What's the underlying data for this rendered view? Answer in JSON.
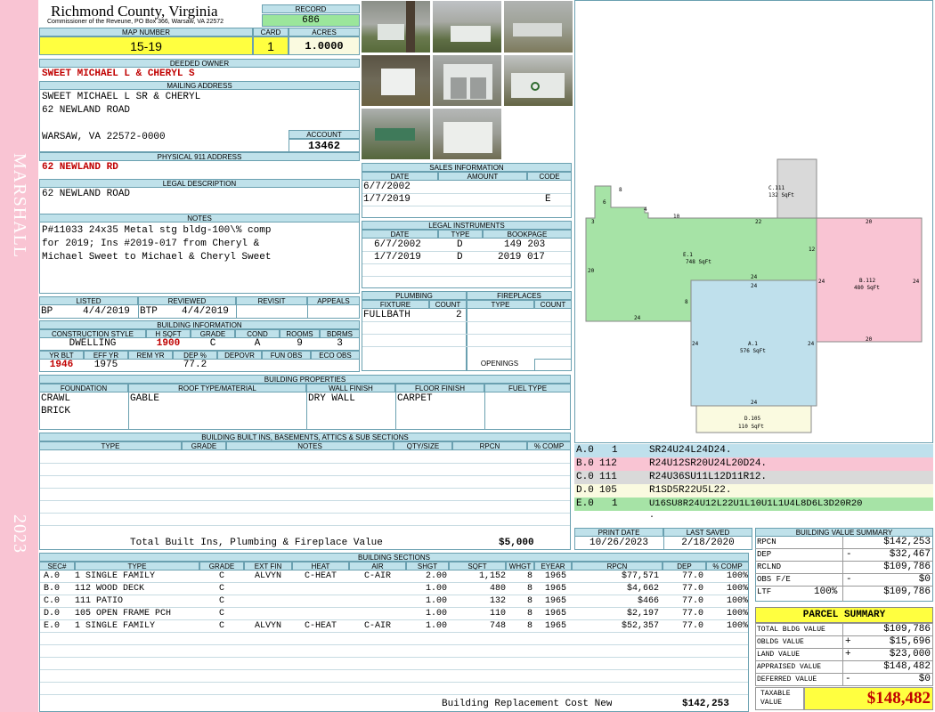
{
  "header": {
    "county": "Richmond County, Virginia",
    "commissioner": "Commissioner of the Reveune, PO Box 366, Warsaw, VA 22572",
    "record_label": "RECORD",
    "record": "686",
    "map_number_label": "MAP NUMBER",
    "map_number": "15-19",
    "card_label": "CARD",
    "card": "1",
    "acres_label": "ACRES",
    "acres": "1.0000"
  },
  "sidebar": {
    "district": "MARSHALL",
    "year": "2023"
  },
  "owner": {
    "deeded_owner_label": "DEEDED OWNER",
    "deeded_owner": "SWEET MICHAEL L & CHERYL S",
    "mailing_label": "MAILING ADDRESS",
    "mailing_lines": [
      "SWEET MICHAEL L SR & CHERYL",
      "62 NEWLAND ROAD",
      "",
      "WARSAW, VA 22572-0000"
    ],
    "account_label": "ACCOUNT",
    "account": "13462",
    "physical_label": "PHYSICAL 911 ADDRESS",
    "physical": "62 NEWLAND RD",
    "legal_label": "LEGAL DESCRIPTION",
    "legal": "62 NEWLAND ROAD",
    "notes_label": "NOTES",
    "notes_lines": [
      "P#11033 24x35 Metal stg bldg-100\\% comp",
      "for 2019; Ins #2019-017 from Cheryl &",
      "Michael Sweet to Michael & Cheryl Sweet"
    ]
  },
  "listing": {
    "listed_label": "LISTED",
    "reviewed_label": "REVIEWED",
    "revisit_label": "REVISIT",
    "appeals_label": "APPEALS",
    "listed_by": "BP",
    "listed_date": "4/4/2019",
    "reviewed_by": "BTP",
    "reviewed_date": "4/4/2019"
  },
  "building_info": {
    "title": "BUILDING INFORMATION",
    "headers": [
      "CONSTRUCTION STYLE",
      "H SQFT",
      "GRADE",
      "COND",
      "ROOMS",
      "BDRMS"
    ],
    "values": [
      "DWELLING",
      "1900",
      "C",
      "A",
      "9",
      "3"
    ],
    "headers2": [
      "YR BLT",
      "EFF YR",
      "REM YR",
      "DEP %",
      "DEPOVR",
      "FUN OBS",
      "ECO OBS"
    ],
    "values2": [
      "1946",
      "1975",
      "",
      "77.2",
      "",
      "",
      ""
    ]
  },
  "properties": {
    "title": "BUILDING PROPERTIES",
    "headers": [
      "FOUNDATION",
      "ROOF TYPE/MATERIAL",
      "WALL FINISH",
      "FLOOR FINISH",
      "FUEL TYPE"
    ],
    "foundation": [
      "CRAWL",
      "BRICK"
    ],
    "roof": "GABLE",
    "wall": "DRY WALL",
    "floor": "CARPET"
  },
  "builtins": {
    "title": "BUILDING BUILT INS, BASEMENTS, ATTICS & SUB SECTIONS",
    "headers": [
      "TYPE",
      "GRADE",
      "NOTES",
      "QTY/SIZE",
      "RPCN",
      "% COMP"
    ],
    "total_label": "Total Built Ins, Plumbing & Fireplace Value",
    "total_value": "$5,000"
  },
  "sales": {
    "title": "SALES INFORMATION",
    "headers": [
      "DATE",
      "AMOUNT",
      "CODE"
    ],
    "rows": [
      {
        "date": "6/7/2002",
        "amount": "",
        "code": ""
      },
      {
        "date": "1/7/2019",
        "amount": "",
        "code": "E"
      }
    ]
  },
  "legal_instruments": {
    "title": "LEGAL INSTRUMENTS",
    "headers": [
      "DATE",
      "TYPE",
      "BOOKPAGE"
    ],
    "rows": [
      {
        "date": "6/7/2002",
        "type": "D",
        "book": "149 203"
      },
      {
        "date": "1/7/2019",
        "type": "D",
        "book": "2019 017"
      }
    ]
  },
  "plumbing": {
    "title": "PLUMBING",
    "headers": [
      "FIXTURE",
      "COUNT"
    ],
    "fixture": "FULLBATH",
    "count": "2"
  },
  "fireplaces": {
    "title": "FIREPLACES",
    "headers": [
      "TYPE",
      "COUNT"
    ],
    "openings_label": "OPENINGS"
  },
  "sketch": {
    "labels": [
      {
        "id": "A.1",
        "area": "576 SqFt"
      },
      {
        "id": "B.112",
        "area": "480 SqFt"
      },
      {
        "id": "C.111",
        "area": "132 SqFt"
      },
      {
        "id": "D.105",
        "area": "110 SqFt"
      },
      {
        "id": "E.1",
        "area": "748 SqFt"
      }
    ],
    "dims": [
      "8",
      "6",
      "4",
      "3",
      "10",
      "22",
      "20",
      "12",
      "20",
      "24",
      "24",
      "24",
      "24",
      "24",
      "20",
      "24",
      "8",
      "20",
      "24",
      "24",
      "24",
      "24"
    ],
    "commands": [
      {
        "sec": "A.0",
        "code": "1",
        "cmd": "SR24U24L24D24.",
        "color": "#bfe0ec"
      },
      {
        "sec": "B.0",
        "code": "112",
        "cmd": "R24U12SR20U24L20D24.",
        "color": "#f9c4d3"
      },
      {
        "sec": "C.0",
        "code": "111",
        "cmd": "R24U36SU11L12D11R12.",
        "color": "#d9d9d9"
      },
      {
        "sec": "D.0",
        "code": "105",
        "cmd": "R1SD5R22U5L22.",
        "color": "#fafae0"
      },
      {
        "sec": "E.0",
        "code": "1",
        "cmd": "U16SU8R24U12L22U1L10U1L1U4L8D6L3D20R20",
        "color": "#a6e3a6"
      }
    ],
    "dot": "."
  },
  "dates": {
    "print_label": "PRINT DATE",
    "print_date": "10/26/2023",
    "saved_label": "LAST SAVED",
    "saved_date": "2/18/2020"
  },
  "value_summary": {
    "title": "BUILDING VALUE SUMMARY",
    "rows": [
      {
        "label": "RPCN",
        "sign": "",
        "pct": "",
        "value": "$142,253"
      },
      {
        "label": "DEP",
        "sign": "-",
        "pct": "",
        "value": "$32,467"
      },
      {
        "label": "RCLND",
        "sign": "",
        "pct": "",
        "value": "$109,786"
      },
      {
        "label": "OBS F/E",
        "sign": "-",
        "pct": "",
        "value": "$0"
      },
      {
        "label": "LTF",
        "sign": "",
        "pct": "100%",
        "value": "$109,786"
      }
    ]
  },
  "parcel_summary": {
    "title": "PARCEL SUMMARY",
    "rows": [
      {
        "label": "TOTAL BLDG VALUE",
        "sign": "",
        "value": "$109,786"
      },
      {
        "label": "OBLDG VALUE",
        "sign": "+",
        "value": "$15,696"
      },
      {
        "label": "LAND VALUE",
        "sign": "+",
        "value": "$23,000"
      },
      {
        "label": "APPRAISED VALUE",
        "sign": "",
        "value": "$148,482"
      },
      {
        "label": "DEFERRED VALUE",
        "sign": "-",
        "value": "$0"
      }
    ],
    "taxable_label": "TAXABLE VALUE",
    "taxable_value": "$148,482"
  },
  "sections": {
    "title": "BUILDING SECTIONS",
    "headers": [
      "SEC#",
      "TYPE",
      "GRADE",
      "EXT FIN",
      "HEAT",
      "AIR",
      "SHGT",
      "SQFT",
      "WHGT",
      "EYEAR",
      "RPCN",
      "DEP",
      "% COMP"
    ],
    "rows": [
      [
        "A.0",
        "1 SINGLE FAMILY",
        "C",
        "ALVYN",
        "C-HEAT",
        "C-AIR",
        "2.00",
        "1,152",
        "8",
        "1965",
        "$77,571",
        "77.0",
        "100%"
      ],
      [
        "B.0",
        "112 WOOD DECK",
        "C",
        "",
        "",
        "",
        "1.00",
        "480",
        "8",
        "1965",
        "$4,662",
        "77.0",
        "100%"
      ],
      [
        "C.0",
        "111 PATIO",
        "C",
        "",
        "",
        "",
        "1.00",
        "132",
        "8",
        "1965",
        "$466",
        "77.0",
        "100%"
      ],
      [
        "D.0",
        "105 OPEN FRAME PCH",
        "C",
        "",
        "",
        "",
        "1.00",
        "110",
        "8",
        "1965",
        "$2,197",
        "77.0",
        "100%"
      ],
      [
        "E.0",
        "1 SINGLE FAMILY",
        "C",
        "ALVYN",
        "C-HEAT",
        "C-AIR",
        "1.00",
        "748",
        "8",
        "1965",
        "$52,357",
        "77.0",
        "100%"
      ]
    ],
    "replacement_label": "Building Replacement Cost New",
    "replacement_value": "$142,253"
  },
  "colors": {
    "label_bg": "#bfe1ea",
    "yellow": "#ffff40",
    "green": "#9be69b",
    "red": "#c00000",
    "sidebar": "#f9c4d3"
  }
}
